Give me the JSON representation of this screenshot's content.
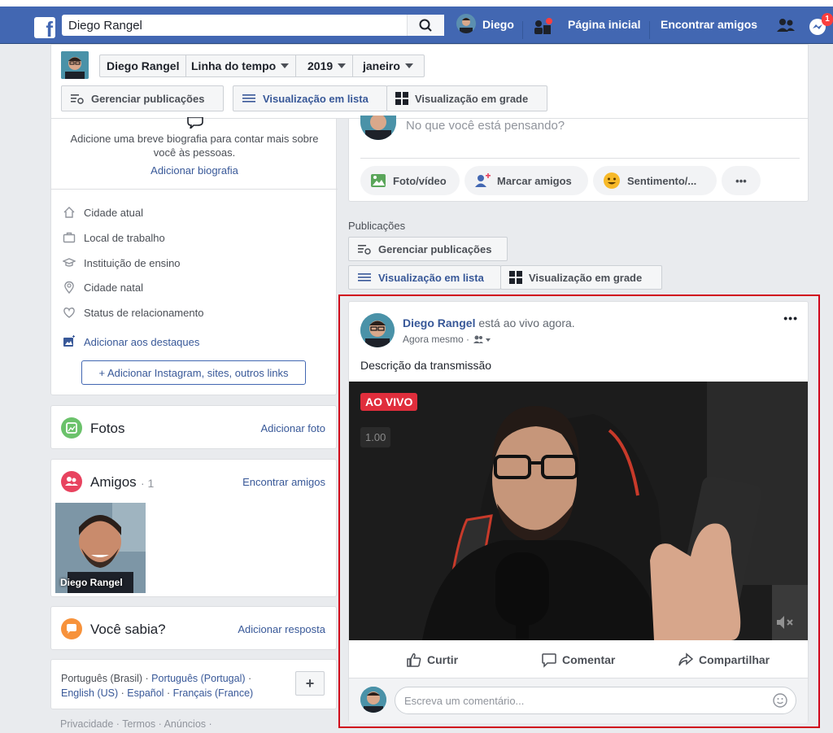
{
  "topbar": {
    "logo": "f",
    "search_value": "Diego Rangel",
    "user_name": "Diego",
    "home": "Página inicial",
    "find_friends": "Encontrar amigos",
    "messenger_badge": "1"
  },
  "profile_bar": {
    "name": "Diego Rangel",
    "timeline": "Linha do tempo",
    "year": "2019",
    "month": "janeiro",
    "manage_posts": "Gerenciar publicações",
    "list_view": "Visualização em lista",
    "grid_view": "Visualização em grade"
  },
  "intro": {
    "bio_prompt": "Adicione uma breve biografia para contar mais sobre você às pessoas.",
    "add_bio": "Adicionar biografia",
    "items": [
      "Cidade atual",
      "Local de trabalho",
      "Instituição de ensino",
      "Cidade natal",
      "Status de relacionamento"
    ],
    "add_highlights": "Adicionar aos destaques",
    "add_links": "+ Adicionar Instagram, sites, outros links"
  },
  "photos": {
    "title": "Fotos",
    "action": "Adicionar foto"
  },
  "friends": {
    "title": "Amigos",
    "count": "· 1",
    "action": "Encontrar amigos",
    "friend_name": "Diego Rangel"
  },
  "did_you_know": {
    "title": "Você sabia?",
    "action": "Adicionar resposta"
  },
  "languages": {
    "current": "Português (Brasil) ·",
    "links": [
      "Português (Portugal)",
      "English (US)",
      "Español",
      "Français (France)"
    ],
    "add": "+"
  },
  "footer": {
    "text": "Privacidade · Termos · Anúncios ·"
  },
  "composer": {
    "placeholder": "No que você está pensando?",
    "photo_video": "Foto/vídeo",
    "tag_friends": "Marcar amigos",
    "feeling": "Sentimento/...",
    "more": "•••"
  },
  "publications": {
    "label": "Publicações",
    "manage": "Gerenciar publicações",
    "list_view": "Visualização em lista",
    "grid_view": "Visualização em grade"
  },
  "post": {
    "author": "Diego Rangel",
    "status": "está ao vivo agora.",
    "time": "Agora mesmo ·",
    "options": "•••",
    "description": "Descrição da transmissão",
    "live_badge": "AO VIVO",
    "speed": "1.00",
    "like": "Curtir",
    "comment": "Comentar",
    "share": "Compartilhar",
    "comment_placeholder": "Escreva um comentário..."
  },
  "colors": {
    "facebook_blue": "#4267b2",
    "link_blue": "#385898",
    "live_red": "#e02e3c",
    "highlight_border": "#d0021b"
  }
}
